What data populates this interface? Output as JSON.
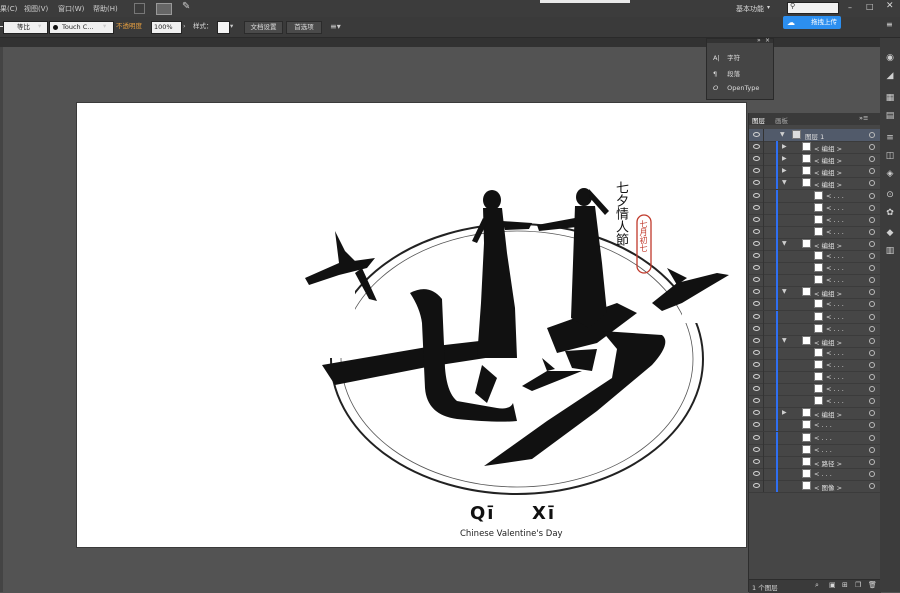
{
  "menubar": {
    "items": [
      "果(C)",
      "视图(V)",
      "窗口(W)",
      "帮助(H)"
    ],
    "workspace_label": "基本功能",
    "upload_button": "拖拽上传"
  },
  "control_bar": {
    "stroke_label": "等比",
    "brush_value": "Touch C...",
    "opacity_label": "不透明度",
    "opacity_value": "100%",
    "style_label": "样式：",
    "doc_setup_button": "文档设置",
    "prefs_button": "首选项"
  },
  "char_panel": {
    "items": [
      {
        "icon": "character-icon",
        "glyph": "A|",
        "label": "字符"
      },
      {
        "icon": "paragraph-icon",
        "glyph": "¶",
        "label": "段落"
      },
      {
        "icon": "opentype-icon",
        "glyph": "O",
        "label": "OpenType"
      }
    ]
  },
  "layers_panel": {
    "tabs": [
      "图层",
      "画板"
    ],
    "layer_name": "图层 1",
    "rows": [
      {
        "label": "< 编组 >",
        "indent": 1,
        "expand": true
      },
      {
        "label": "< 编组 >",
        "indent": 1,
        "expand": true
      },
      {
        "label": "< 编组 >",
        "indent": 1,
        "expand": true
      },
      {
        "label": "< 编组 >",
        "indent": 1,
        "expand": true,
        "open": true
      },
      {
        "label": "< . . .",
        "indent": 2
      },
      {
        "label": "< . . .",
        "indent": 2
      },
      {
        "label": "< . . .",
        "indent": 2
      },
      {
        "label": "< . . .",
        "indent": 2
      },
      {
        "label": "< 编组 >",
        "indent": 1,
        "expand": true,
        "open": true
      },
      {
        "label": "< . . .",
        "indent": 2
      },
      {
        "label": "< . . .",
        "indent": 2
      },
      {
        "label": "< . . .",
        "indent": 2
      },
      {
        "label": "< 编组 >",
        "indent": 1,
        "expand": true,
        "open": true
      },
      {
        "label": "< . . .",
        "indent": 2
      },
      {
        "label": "< . . .",
        "indent": 2
      },
      {
        "label": "< . . .",
        "indent": 2
      },
      {
        "label": "< 编组 >",
        "indent": 1,
        "expand": true,
        "open": true
      },
      {
        "label": "< . . .",
        "indent": 2
      },
      {
        "label": "< . . .",
        "indent": 2
      },
      {
        "label": "< . . .",
        "indent": 2
      },
      {
        "label": "< . . .",
        "indent": 2
      },
      {
        "label": "< . . .",
        "indent": 2
      },
      {
        "label": "< 编组 >",
        "indent": 1,
        "expand": true
      },
      {
        "label": "< . . .",
        "indent": 1
      },
      {
        "label": "< . . .",
        "indent": 1
      },
      {
        "label": "< . . .",
        "indent": 1
      },
      {
        "label": "< 路径 >",
        "indent": 1
      },
      {
        "label": "< . . .",
        "indent": 1
      },
      {
        "label": "< 图像 >",
        "indent": 1
      }
    ],
    "footer": "1 个图层"
  },
  "artwork": {
    "big_title": "七夕",
    "vertical_text": "七夕情人節",
    "seal_text": "七月初七",
    "pinyin_left": "Qī",
    "pinyin_right": "Xī",
    "subtitle": "Chinese Valentine's Day"
  }
}
